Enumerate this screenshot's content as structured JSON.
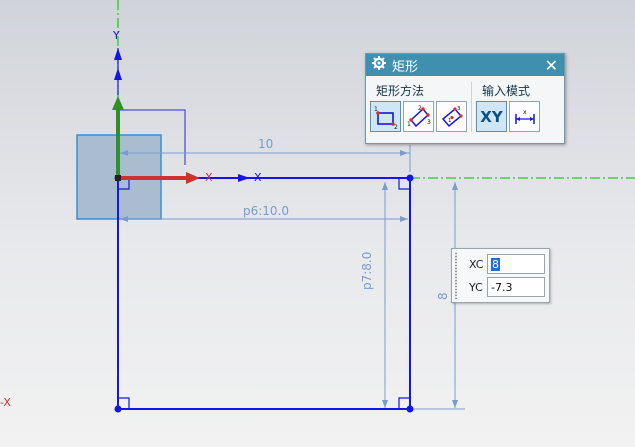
{
  "dialog": {
    "title": "矩形",
    "close": "✕",
    "method_group": {
      "label": "矩形方法",
      "buttons": [
        "by-two-points",
        "by-three-points",
        "from-center"
      ]
    },
    "input_group": {
      "label": "输入模式",
      "buttons": [
        {
          "id": "coordinate-mode",
          "label": "XY"
        },
        {
          "id": "parameter-mode",
          "label": ""
        }
      ]
    }
  },
  "coords": {
    "xc_label": "XC",
    "xc_value": "8",
    "yc_label": "YC",
    "yc_value": "-7.3"
  },
  "dimensions": {
    "top_value": "10",
    "width_label": "p6:10.0",
    "height_label": "p7:8.0",
    "right_value": "8"
  },
  "axes": {
    "y_label": "Y",
    "x_label": "X",
    "neg_x_label": "-X"
  },
  "colors": {
    "sketch": "#1515e6",
    "dim": "#7a9ccc",
    "dialog_title": "#3f8fae",
    "green_axis": "#22cc22",
    "x_arrow": "#d03030",
    "y_arrow": "#2f8f2f",
    "selection_box": "#a9bcd0"
  }
}
